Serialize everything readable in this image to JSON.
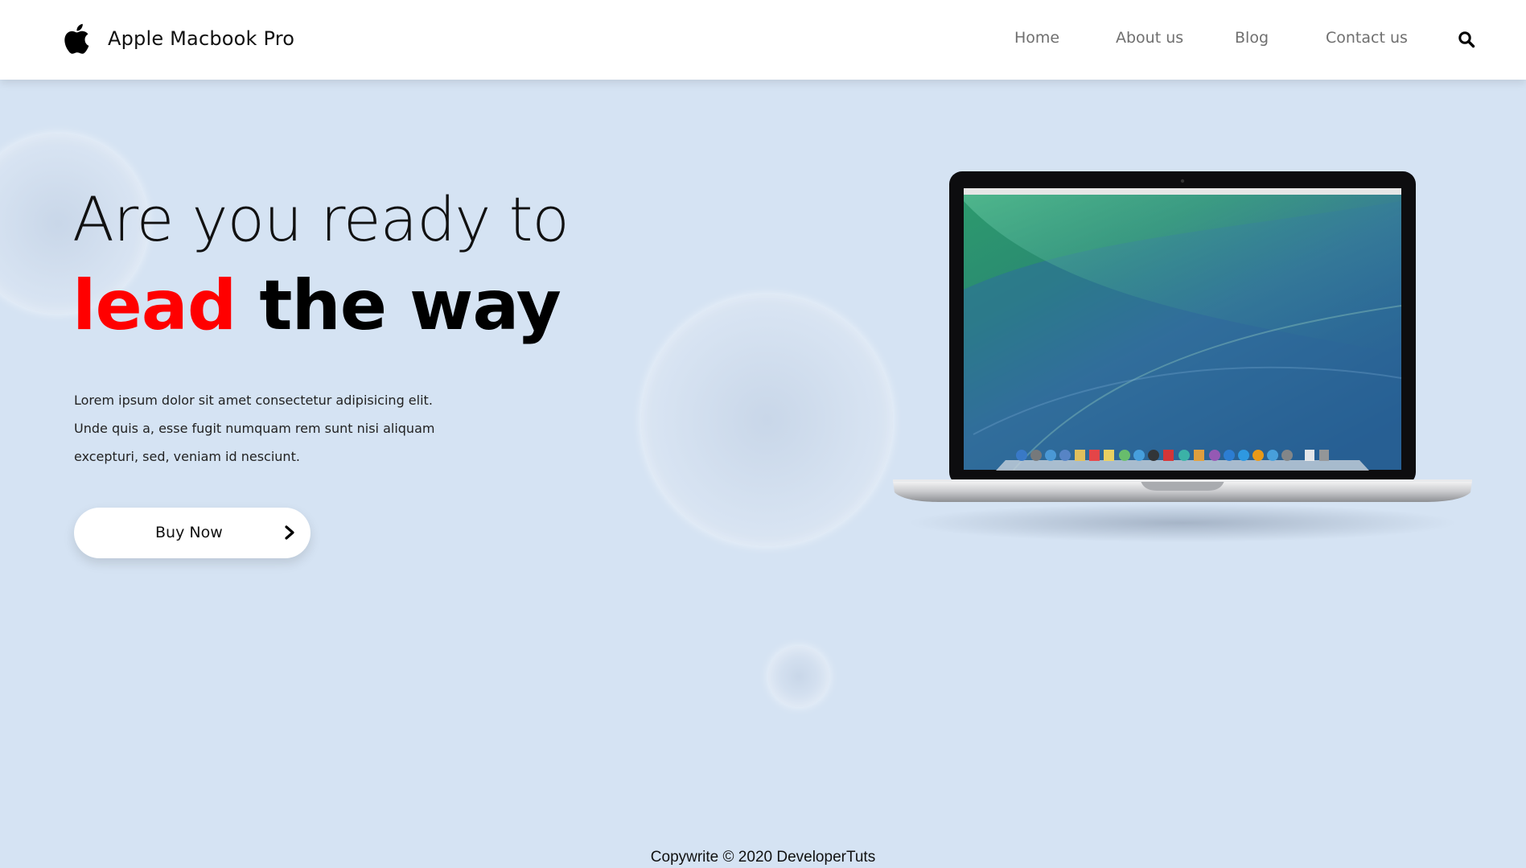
{
  "brand": {
    "logo_icon": "apple-logo-icon",
    "name": "Apple Macbook Pro"
  },
  "nav": {
    "items": [
      {
        "label": "Home"
      },
      {
        "label": "About us"
      },
      {
        "label": "Blog"
      },
      {
        "label": "Contact us"
      }
    ],
    "search_icon": "search-icon"
  },
  "hero": {
    "headline_line1": "Are you ready to",
    "headline_accent": "lead",
    "headline_rest": "the way",
    "intro": "Lorem ipsum dolor sit amet consectetur adipisicing elit. Unde quis a, esse fugit numquam rem sunt nisi aliquam excepturi, sed, veniam id nesciunt.",
    "cta_label": "Buy Now",
    "cta_icon": "chevron-right-icon",
    "product_image": "macbook-pro-laptop-image"
  },
  "footer": {
    "text": "Copywrite © 2020 DeveloperTuts"
  },
  "colors": {
    "background": "#d5e3f3",
    "header": "#ffffff",
    "accent": "#ff0000",
    "nav_text": "#6f6f6f"
  }
}
